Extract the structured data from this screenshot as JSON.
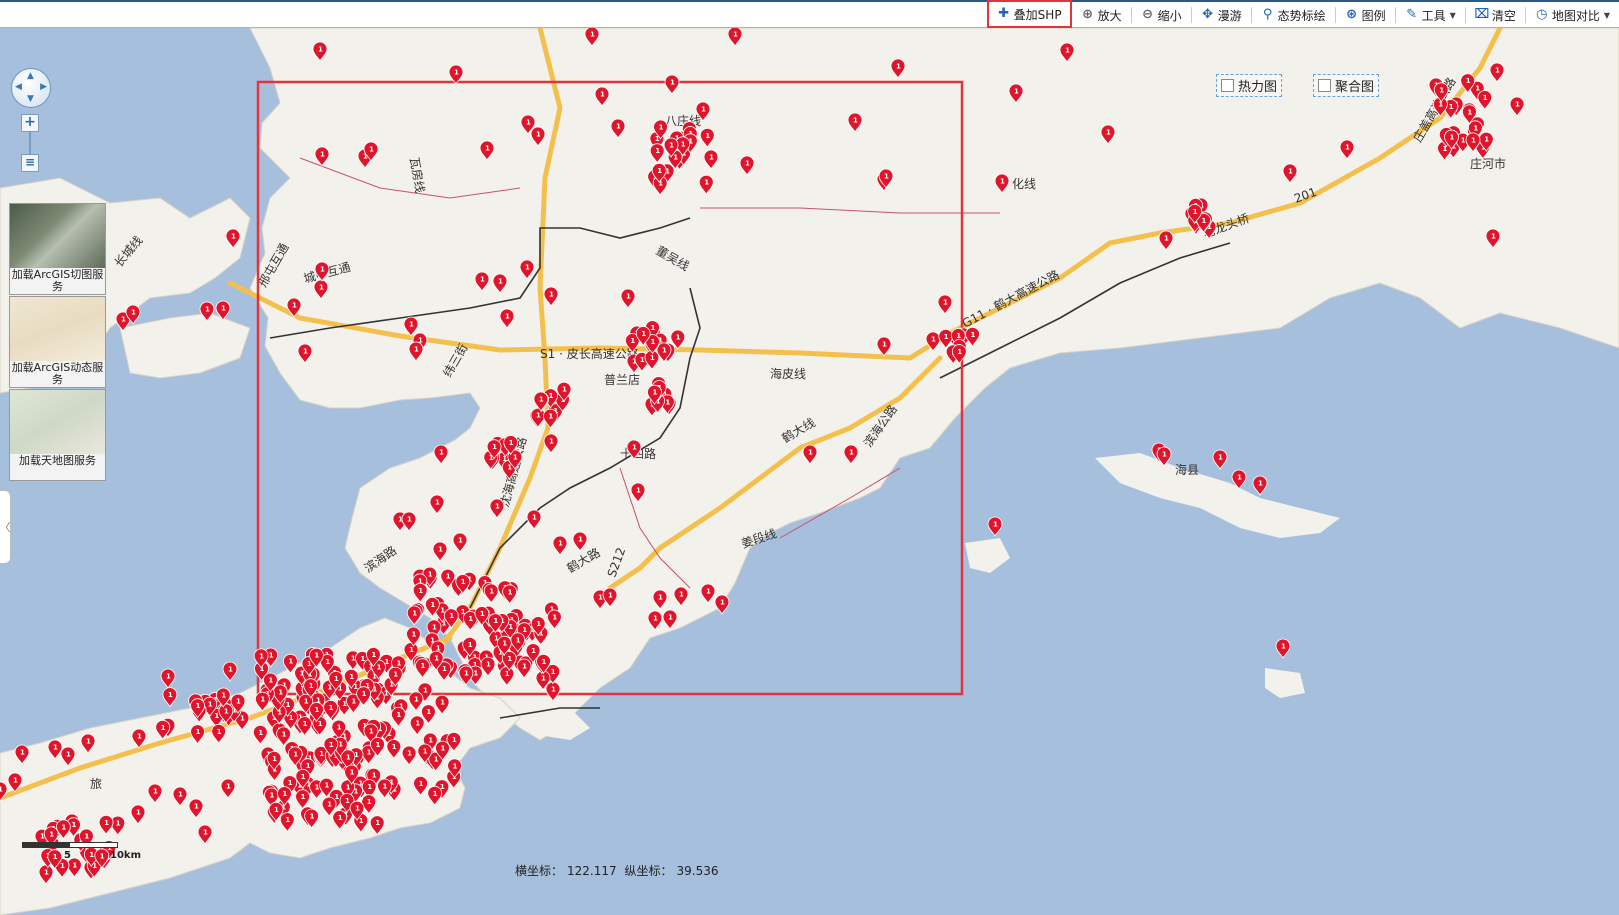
{
  "toolbar": {
    "add_shp": "叠加SHP",
    "zoom_in": "放大",
    "zoom_out": "缩小",
    "pan": "漫游",
    "situation": "态势标绘",
    "legend": "图例",
    "tools": "工具",
    "clear": "清空",
    "compare": "地图对比"
  },
  "layers": {
    "heatmap": "热力图",
    "cluster": "聚合图"
  },
  "basemaps": [
    {
      "label": "加载ArcGIS切图服务"
    },
    {
      "label": "加载ArcGIS动态服务"
    },
    {
      "label": "加载天地图服务"
    }
  ],
  "status": {
    "x_label": "横坐标：",
    "x_value": "122.117",
    "y_label": "纵坐标：",
    "y_value": "39.536"
  },
  "scale": {
    "mid": "5",
    "end": "10km"
  },
  "marker_text": "1",
  "map_labels": [
    "八庄线",
    "沈海高速公路",
    "G11 · 鹤大高速公路",
    "S1 · 皮长高速公路",
    "海皮线",
    "鹤大线",
    "姜段线",
    "鹤大路",
    "S212",
    "普兰店",
    "滨海路",
    "滨海公路",
    "老龙头桥",
    "201",
    "庄河市",
    "海县",
    "瓦房线",
    "旅",
    "纬三街",
    "十四路",
    "董吴线",
    "长城线",
    "邢屯互通",
    "城中互通",
    "化线",
    "庄盖高速公路"
  ],
  "colors": {
    "sea": "#a5bfdd",
    "land": "#f3f1ec",
    "marker": "#e0142b",
    "highway": "#f4c04d",
    "selection": "#e2343a"
  }
}
